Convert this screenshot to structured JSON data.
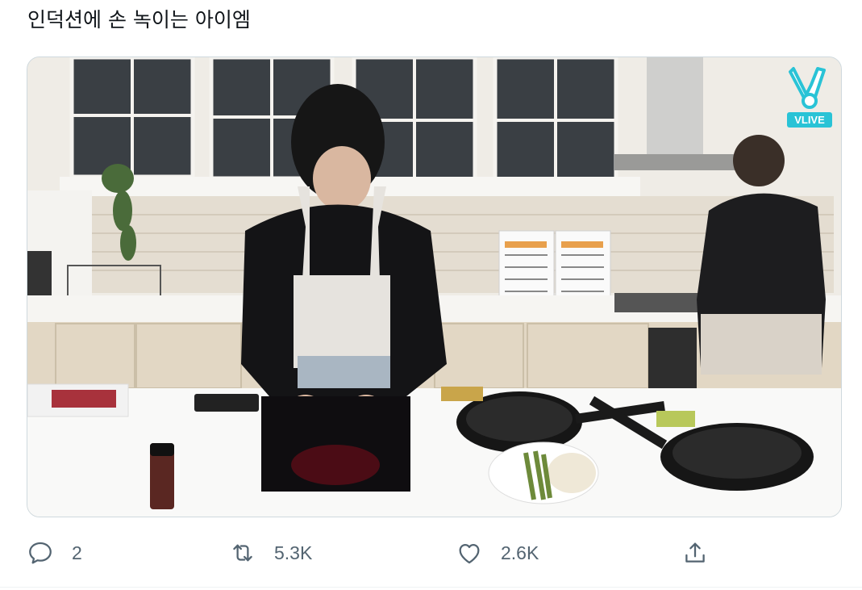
{
  "tweet": {
    "text": "인덕션에 손 녹이는 아이엠"
  },
  "media": {
    "alt": "video screenshot of a kitchen",
    "watermark_text": "VLIVE",
    "brand_color": "#29c3d6"
  },
  "actions": {
    "reply": {
      "icon": "reply-icon",
      "count": "2"
    },
    "retweet": {
      "icon": "retweet-icon",
      "count": "5.3K"
    },
    "like": {
      "icon": "heart-icon",
      "count": "2.6K"
    },
    "share": {
      "icon": "share-icon"
    }
  },
  "colors": {
    "icon": "#536471",
    "text": "#0f1419"
  }
}
